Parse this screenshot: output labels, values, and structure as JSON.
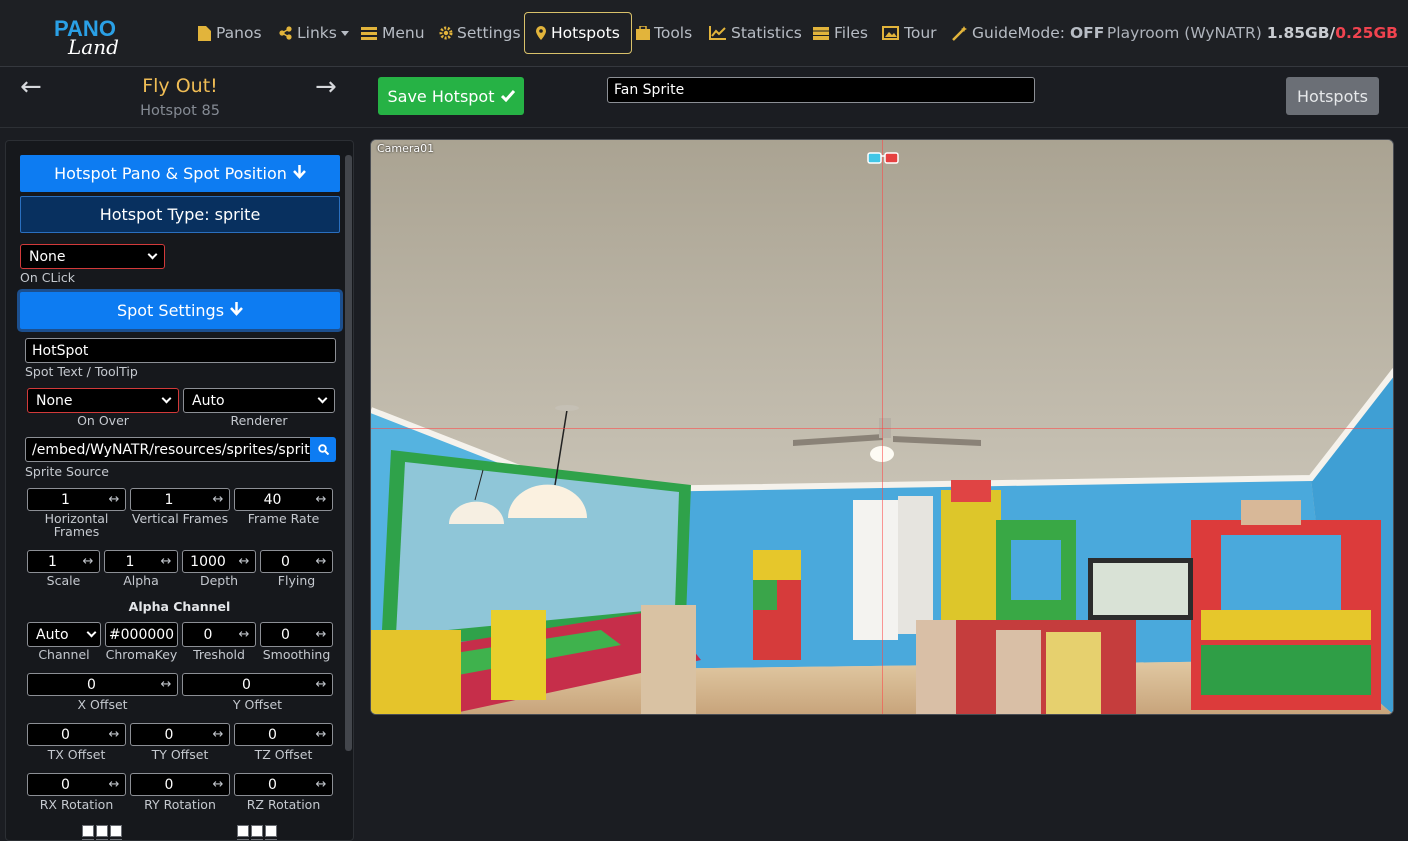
{
  "nav": {
    "logo_top": "PANO",
    "logo_bottom": "Land",
    "items": [
      {
        "label": "Panos",
        "icon": "file-icon"
      },
      {
        "label": "Links",
        "icon": "share-icon"
      },
      {
        "label": "Menu",
        "icon": "list-icon"
      },
      {
        "label": "Settings",
        "icon": "gear-icon"
      },
      {
        "label": "Hotspots",
        "icon": "map-marker-icon"
      },
      {
        "label": "Tools",
        "icon": "toolbox-icon"
      },
      {
        "label": "Statistics",
        "icon": "chart-line-icon"
      },
      {
        "label": "Files",
        "icon": "archive-icon"
      },
      {
        "label": "Tour",
        "icon": "image-icon"
      },
      {
        "label": "GuideMode:",
        "icon": "magic-wand-icon"
      }
    ],
    "guide_mode_value": "OFF",
    "usage_label": "Playroom (WyNATR)",
    "usage_used": "1.85GB",
    "usage_sep": "/",
    "usage_free": "0.25GB",
    "accent_color": "#e2b43b",
    "danger_color": "#f0434f"
  },
  "header": {
    "prev_arrow": "←",
    "next_arrow": "→",
    "title": "Fly Out!",
    "subtitle": "Hotspot 85",
    "save_label": "Save Hotspot",
    "hotspot_name_value": "Fan Sprite",
    "hotspots_button": "Hotspots"
  },
  "panel": {
    "pano_position_button": "Hotspot Pano & Spot Position",
    "hotspot_type_button": "Hotspot Type: sprite",
    "on_click_value": "None",
    "on_click_label": "On CLick",
    "spot_settings_button": "Spot Settings",
    "spot_text_value": "HotSpot",
    "spot_text_label": "Spot Text / ToolTip",
    "on_over_value": "None",
    "on_over_label": "On Over",
    "renderer_value": "Auto",
    "renderer_label": "Renderer",
    "sprite_source_value": "/embed/WyNATR/resources/sprites/sprit",
    "sprite_source_label": "Sprite Source",
    "hframes_value": "1",
    "hframes_label": "Horizontal Frames",
    "vframes_value": "1",
    "vframes_label": "Vertical Frames",
    "framerate_value": "40",
    "framerate_label": "Frame Rate",
    "scale_value": "1",
    "scale_label": "Scale",
    "alpha_value": "1",
    "alpha_label": "Alpha",
    "depth_value": "1000",
    "depth_label": "Depth",
    "flying_value": "0",
    "flying_label": "Flying",
    "alpha_channel_heading": "Alpha Channel",
    "channel_value": "Auto",
    "channel_label": "Channel",
    "chromakey_value": "#000000",
    "chromakey_label": "ChromaKey",
    "threshold_value": "0",
    "threshold_label": "Treshold",
    "smoothing_value": "0",
    "smoothing_label": "Smoothing",
    "xoffset_value": "0",
    "xoffset_label": "X Offset",
    "yoffset_value": "0",
    "yoffset_label": "Y Offset",
    "txoffset_value": "0",
    "txoffset_label": "TX Offset",
    "tyoffset_value": "0",
    "tyoffset_label": "TY Offset",
    "tzoffset_value": "0",
    "tzoffset_label": "TZ Offset",
    "rxrot_value": "0",
    "rxrot_label": "RX Rotation",
    "ryrot_value": "0",
    "ryrot_label": "RY Rotation",
    "rzrot_value": "0",
    "rzrot_label": "RZ Rotation",
    "stepper_glyph": "↔"
  },
  "viewer": {
    "camera_label": "Camera01"
  }
}
